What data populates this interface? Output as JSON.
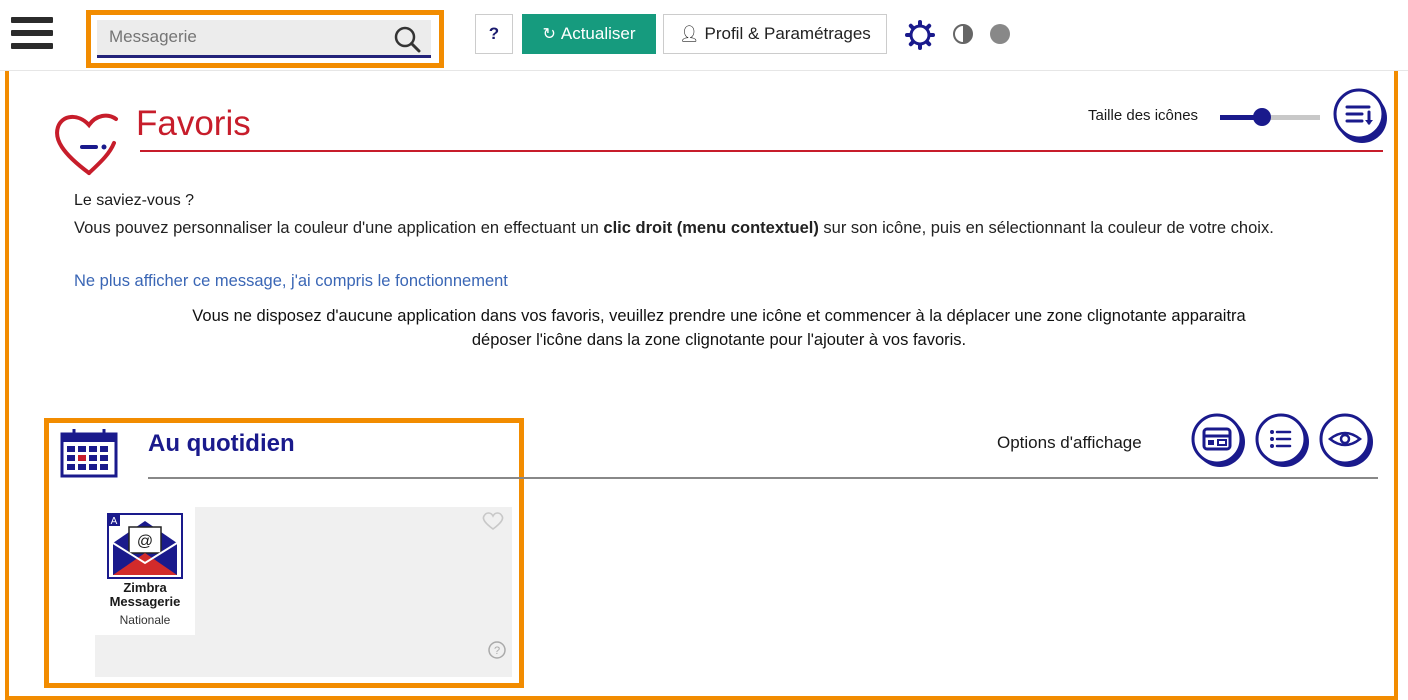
{
  "topbar": {
    "search_placeholder": "Messagerie",
    "help_label": "?",
    "refresh_label": "Actualiser",
    "profile_label": "Profil & Paramétrages"
  },
  "favoris": {
    "title": "Favoris",
    "icon_size_label": "Taille des icônes",
    "icon_size_level": 0.42
  },
  "tip": {
    "title": "Le saviez-vous ?",
    "body_before": "Vous pouvez personnaliser la couleur d'une application en effectuant un ",
    "body_bold": "clic droit (menu contextuel)",
    "body_after": " sur son icône, puis en sélectionnant la couleur de votre choix.",
    "dismiss_link": "Ne plus afficher ce message, j'ai compris le fonctionnement",
    "empty_line1": "Vous ne disposez d'aucune application dans vos favoris, veuillez prendre une icône et commencer à la déplacer une zone clignotante apparaitra",
    "empty_line2": "déposer l'icône dans la zone clignotante pour l'ajouter à vos favoris."
  },
  "section": {
    "title": "Au quotidien",
    "options_label": "Options d'affichage"
  },
  "app": {
    "name_line1": "Zimbra",
    "name_line2": "Messagerie",
    "subtitle": "Nationale",
    "badge": "A"
  },
  "colors": {
    "accent_orange": "#f28c00",
    "brand_red": "#c71d2b",
    "navy": "#1a1a8c",
    "green": "#169b7e",
    "link_blue": "#3a66b5"
  }
}
